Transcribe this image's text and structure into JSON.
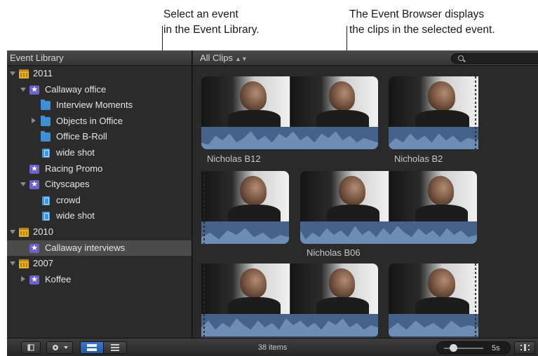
{
  "callouts": {
    "left": [
      "Select an event",
      "in the Event Library."
    ],
    "right": [
      "The Event Browser displays",
      "the clips in the selected event."
    ]
  },
  "sidebar": {
    "title": "Event Library",
    "items": [
      {
        "label": "2011",
        "icon": "calendar-icon",
        "expander": "open"
      },
      {
        "label": "Callaway office",
        "icon": "event-star-icon",
        "expander": "open"
      },
      {
        "label": "Interview Moments",
        "icon": "folder-icon",
        "expander": "none"
      },
      {
        "label": "Objects in Office",
        "icon": "folder-icon",
        "expander": "closed"
      },
      {
        "label": "Office B-Roll",
        "icon": "folder-icon",
        "expander": "none"
      },
      {
        "label": "wide shot",
        "icon": "keyword-clip-icon",
        "expander": "none"
      },
      {
        "label": "Racing Promo",
        "icon": "event-star-icon",
        "expander": "none"
      },
      {
        "label": "Cityscapes",
        "icon": "event-star-icon",
        "expander": "open"
      },
      {
        "label": "crowd",
        "icon": "keyword-clip-icon",
        "expander": "none"
      },
      {
        "label": "wide shot",
        "icon": "keyword-clip-icon",
        "expander": "none"
      },
      {
        "label": "2010",
        "icon": "calendar-icon",
        "expander": "open"
      },
      {
        "label": "Callaway interviews",
        "icon": "event-star-icon",
        "expander": "none",
        "selected": true
      },
      {
        "label": "2007",
        "icon": "calendar-icon",
        "expander": "open"
      },
      {
        "label": "Koffee",
        "icon": "event-star-icon",
        "expander": "closed"
      }
    ]
  },
  "browser": {
    "filter_label": "All Clips",
    "clips": [
      {
        "title": "Nicholas B12"
      },
      {
        "title": "Nicholas B2"
      },
      {
        "title": ""
      },
      {
        "title": "Nicholas B06"
      },
      {
        "title": ""
      },
      {
        "title": ""
      }
    ]
  },
  "toolbar": {
    "items_count": "38 items",
    "zoom_label": "5s"
  },
  "colors": {
    "accent_blue": "#2f6fbf",
    "event_star": "#6c62c8",
    "folder": "#3e8fd6",
    "calendar": "#e3b323",
    "waveform": "#46628a"
  }
}
